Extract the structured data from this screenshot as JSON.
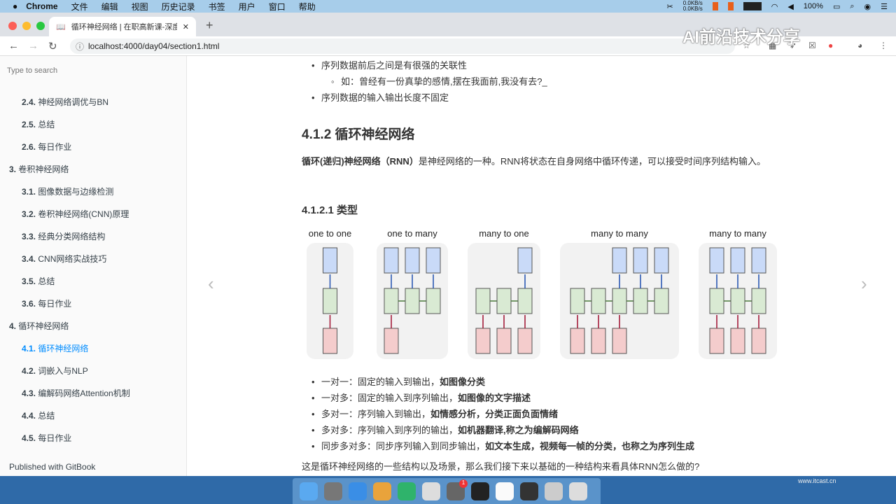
{
  "menubar": {
    "app": "Chrome",
    "items": [
      "文件",
      "编辑",
      "视图",
      "历史记录",
      "书签",
      "用户",
      "窗口",
      "帮助"
    ],
    "net_up": "0.0KB/s",
    "net_down": "0.0KB/s",
    "battery": "100%"
  },
  "tab": {
    "title": "循环神经网络 | 在职高新课-深度"
  },
  "address": {
    "url": "localhost:4000/day04/section1.html"
  },
  "watermark": "AI前沿技术分享",
  "sidebar": {
    "search_placeholder": "Type to search",
    "items": [
      {
        "num": "2.4.",
        "label": "神经网络调优与BN",
        "level": 2
      },
      {
        "num": "2.5.",
        "label": "总结",
        "level": 2
      },
      {
        "num": "2.6.",
        "label": "每日作业",
        "level": 2
      },
      {
        "num": "3.",
        "label": "卷积神经网络",
        "level": 1
      },
      {
        "num": "3.1.",
        "label": "图像数据与边缘检测",
        "level": 2
      },
      {
        "num": "3.2.",
        "label": "卷积神经网络(CNN)原理",
        "level": 2
      },
      {
        "num": "3.3.",
        "label": "经典分类网络结构",
        "level": 2
      },
      {
        "num": "3.4.",
        "label": "CNN网络实战技巧",
        "level": 2
      },
      {
        "num": "3.5.",
        "label": "总结",
        "level": 2
      },
      {
        "num": "3.6.",
        "label": "每日作业",
        "level": 2
      },
      {
        "num": "4.",
        "label": "循环神经网络",
        "level": 1
      },
      {
        "num": "4.1.",
        "label": "循环神经网络",
        "level": 2,
        "active": true
      },
      {
        "num": "4.2.",
        "label": "词嵌入与NLP",
        "level": 2
      },
      {
        "num": "4.3.",
        "label": "编解码网络Attention机制",
        "level": 2
      },
      {
        "num": "4.4.",
        "label": "总结",
        "level": 2
      },
      {
        "num": "4.5.",
        "label": "每日作业",
        "level": 2
      }
    ],
    "published": "Published with GitBook"
  },
  "content": {
    "top_bullets": [
      "序列数据前后之间是有很强的关联性",
      "如：曾经有一份真挚的感情,摆在我面前,我没有去?_",
      "序列数据的输入输出长度不固定"
    ],
    "heading": "4.1.2 循环神经网络",
    "intro_bold": "循环(递归)神经网络（RNN）",
    "intro_rest": "是神经网络的一种。RNN将状态在自身网络中循环传递，可以接受时间序列结构输入。",
    "subheading": "4.1.2.1 类型",
    "diagram": [
      {
        "title": "one to one",
        "cols": 1,
        "inputs": [
          0
        ],
        "outputs": [
          0
        ]
      },
      {
        "title": "one to many",
        "cols": 3,
        "inputs": [
          0
        ],
        "outputs": [
          0,
          1,
          2
        ]
      },
      {
        "title": "many to one",
        "cols": 3,
        "inputs": [
          0,
          1,
          2
        ],
        "outputs": [
          2
        ]
      },
      {
        "title": "many to many",
        "cols": 5,
        "inputs": [
          0,
          1,
          2
        ],
        "outputs": [
          2,
          3,
          4
        ]
      },
      {
        "title": "many to many",
        "cols": 3,
        "inputs": [
          0,
          1,
          2
        ],
        "outputs": [
          0,
          1,
          2
        ]
      }
    ],
    "types": [
      {
        "a": "一对一：固定的输入到输出，",
        "b": "如图像分类"
      },
      {
        "a": "一对多：固定的输入到序列输出，",
        "b": "如图像的文字描述"
      },
      {
        "a": "多对一：序列输入到输出，",
        "b": "如情感分析，分类正面负面情绪"
      },
      {
        "a": "多对多：序列输入到序列的输出，",
        "b": "如机器翻译,称之为编解码网络"
      },
      {
        "a": "同步多对多：同步序列输入到同步输出，",
        "b": "如文本生成，视频每一帧的分类，也称之为序列生成"
      }
    ],
    "closing": "这是循环神经网络的一些结构以及场景，那么我们接下来以基础的一种结构来看具体RNN怎么做的?"
  },
  "dock": [
    "Finder",
    "Launchpad",
    "Safari",
    "Chrome",
    "PyCharm",
    "Keynote",
    "System Preferences",
    "Terminal",
    "Typora",
    "OBS",
    "Preview",
    "Trash"
  ],
  "dock_badge": "1",
  "itcast": "www.itcast.cn"
}
